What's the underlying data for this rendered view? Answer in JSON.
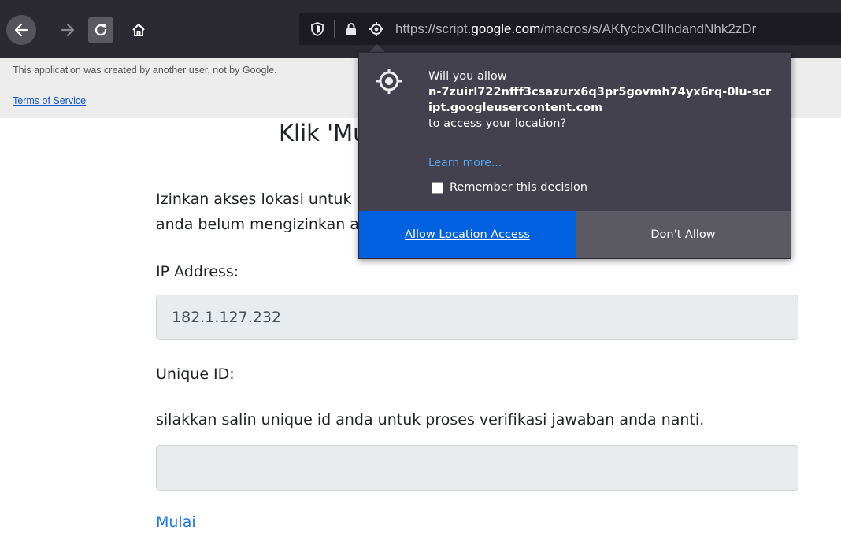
{
  "browser": {
    "url_prefix": "https://script.",
    "url_domain": "google.com",
    "url_path": "/macros/s/AKfycbxCllhdandNhk2zDr",
    "icons": {
      "back": "back-arrow-icon",
      "forward": "forward-arrow-icon",
      "reload": "reload-icon",
      "home": "home-icon",
      "shield": "shield-icon",
      "lock": "lock-icon",
      "location": "location-icon"
    }
  },
  "banner": {
    "notice": "This application was created by another user, not by Google.",
    "terms_link": "Terms of Service"
  },
  "page": {
    "heading": "Klik 'Mulai'",
    "paragraph_line1": "Izinkan akses lokasi untuk melanjutkan, klik 'Mulai' lagi jika",
    "paragraph_line2": "anda belum mengizinkan akses lokasi.",
    "ip_label": "IP Address:",
    "ip_value": "182.1.127.232",
    "uid_label": "Unique ID:",
    "uid_hint": "silakkan salin unique id anda untuk proses verifikasi jawaban anda nanti.",
    "uid_value": "",
    "start_link": "Mulai"
  },
  "popup": {
    "msg_prefix": "Will you allow",
    "msg_host": "n-7zuirl722nfff3csazurx6q3pr5govmh74yx6rq-0lu-script.googleusercontent.com",
    "msg_suffix": "to access your location?",
    "learn_more": "Learn more...",
    "remember_label": "Remember this decision",
    "remember_checked": false,
    "allow_button": "Allow Location Access",
    "deny_button": "Don't Allow"
  },
  "colors": {
    "toolbar_bg": "#2b2a33",
    "popup_bg": "#42414d",
    "allow_bg": "#0061e0",
    "deny_bg": "#5b5a63",
    "link": "#1a73e8"
  }
}
